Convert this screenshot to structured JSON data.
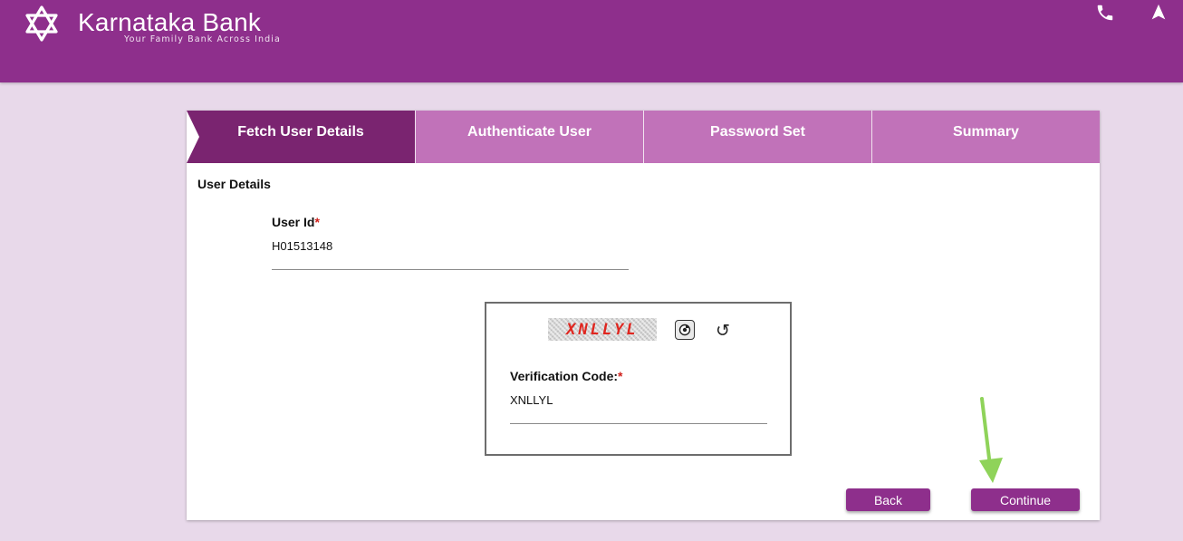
{
  "header": {
    "brand_name": "Karnataka Bank",
    "tagline": "Your Family Bank Across India",
    "background_color": "#8e2f8c",
    "icons": [
      "star-of-david-logo-icon",
      "phone-icon",
      "navigation-arrow-icon"
    ]
  },
  "steps": [
    {
      "label": "Fetch User Details",
      "active": true
    },
    {
      "label": "Authenticate User",
      "active": false
    },
    {
      "label": "Password Set",
      "active": false
    },
    {
      "label": "Summary",
      "active": false
    }
  ],
  "form": {
    "section_title": "User Details",
    "user_id": {
      "label": "User Id",
      "required_mark": "*",
      "value": "H01513148"
    },
    "captcha": {
      "image_text": "XNLLYL",
      "audio_icon": "audio-captcha-icon",
      "refresh_icon": "refresh-icon"
    },
    "verification_code": {
      "label": "Verification Code:",
      "required_mark": "*",
      "value": "XNLLYL"
    }
  },
  "buttons": {
    "back_label": "Back",
    "continue_label": "Continue"
  },
  "colors": {
    "brand": "#8e2f8c",
    "active_step": "#7a2470",
    "inactive_step": "#c172b9",
    "required": "#d0211c",
    "annotation_arrow": "#8fd35a"
  }
}
